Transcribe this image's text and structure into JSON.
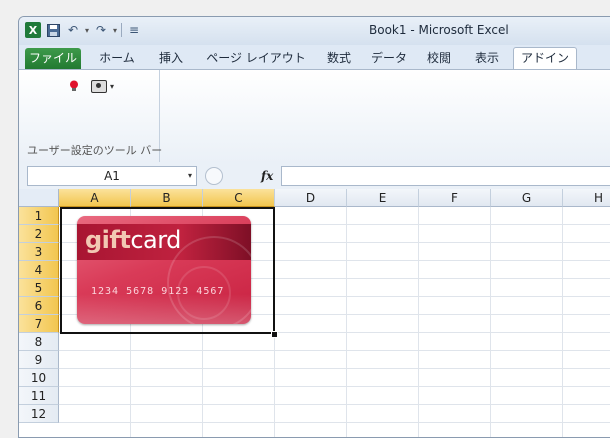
{
  "window": {
    "title": "Book1 - Microsoft Excel"
  },
  "qat": {
    "app_icon": "X"
  },
  "tabs": [
    {
      "label": "ファイル",
      "id": "file"
    },
    {
      "label": "ホーム",
      "id": "home"
    },
    {
      "label": "挿入",
      "id": "insert"
    },
    {
      "label": "ページ レイアウト",
      "id": "page-layout"
    },
    {
      "label": "数式",
      "id": "formulas"
    },
    {
      "label": "データ",
      "id": "data"
    },
    {
      "label": "校閲",
      "id": "review"
    },
    {
      "label": "表示",
      "id": "view"
    },
    {
      "label": "アドイン",
      "id": "addins"
    }
  ],
  "active_tab": "アドイン",
  "ribbon": {
    "group_label": "ユーザー設定のツール バー"
  },
  "formula_bar": {
    "name_box": "A1",
    "fx_label": "fx",
    "formula": ""
  },
  "columns": [
    "A",
    "B",
    "C",
    "D",
    "E",
    "F",
    "G",
    "H"
  ],
  "rows": [
    "1",
    "2",
    "3",
    "4",
    "5",
    "6",
    "7",
    "8",
    "9",
    "10",
    "11",
    "12"
  ],
  "selected_columns": [
    "A",
    "B",
    "C"
  ],
  "selected_rows": [
    "1",
    "2",
    "3",
    "4",
    "5",
    "6",
    "7"
  ],
  "card": {
    "title_gift": "gift",
    "title_card": "card",
    "number": "1234 5678 9123 4567"
  },
  "colors": {
    "file_tab": "#2e8b3e",
    "selection_header": "#f6cd5f",
    "card_red": "#d93b58"
  }
}
